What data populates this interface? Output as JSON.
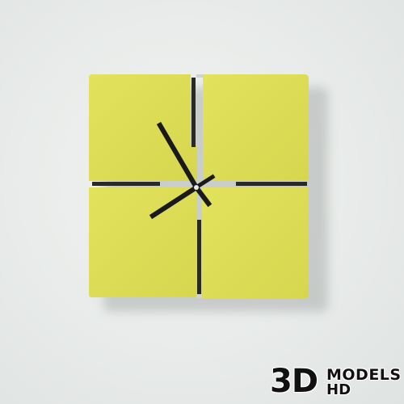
{
  "scene": {
    "subject": "square-wall-clock",
    "colors": {
      "wall": "#e8ebe9",
      "clock_face": "#dede56",
      "clock_face_shade": "#d4d44e",
      "hands": "#1a1a1a",
      "center_pin": "#e8e8e8"
    }
  },
  "watermark": {
    "big": "3D",
    "line1": "MODELS",
    "line2": "HD"
  }
}
